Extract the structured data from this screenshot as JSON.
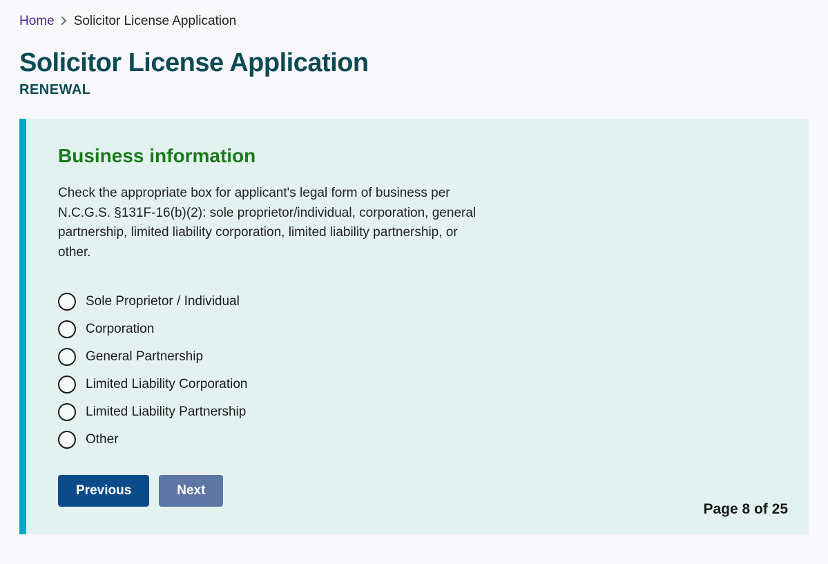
{
  "breadcrumb": {
    "home": "Home",
    "current": "Solicitor License Application"
  },
  "page_title": "Solicitor License Application",
  "page_subtitle": "RENEWAL",
  "section_heading": "Business information",
  "instructions": "Check the appropriate box for applicant's legal form of business per N.C.G.S. §131F-16(b)(2): sole proprietor/individual, corporation, general partnership, limited liability corporation, limited liability partnership, or other.",
  "options": [
    "Sole Proprietor / Individual",
    "Corporation",
    "General Partnership",
    "Limited Liability Corporation",
    "Limited Liability Partnership",
    "Other"
  ],
  "buttons": {
    "previous": "Previous",
    "next": "Next"
  },
  "pager": "Page 8 of 25"
}
